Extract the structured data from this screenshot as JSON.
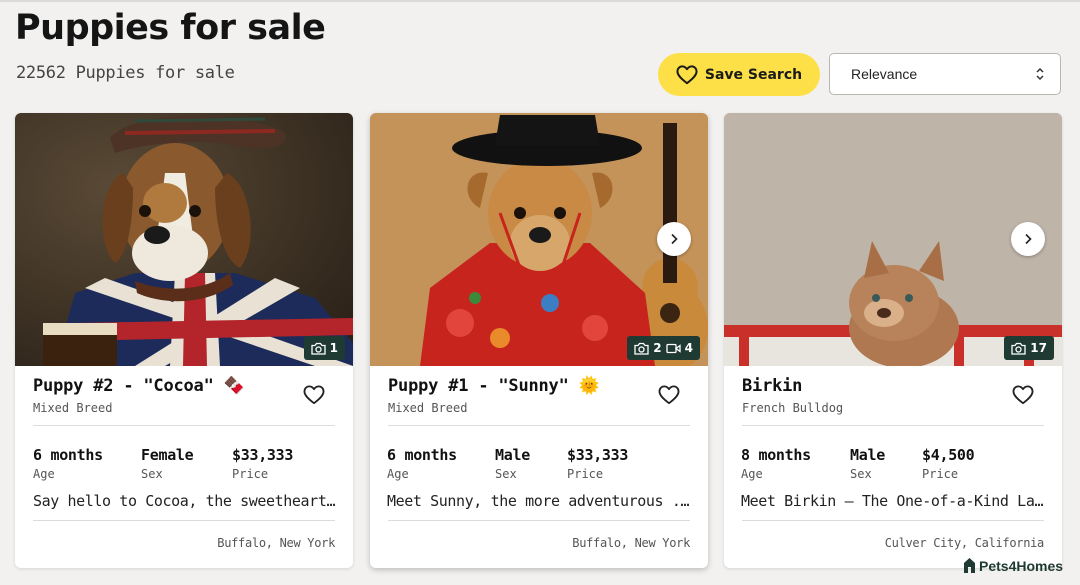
{
  "header": {
    "title": "Puppies for sale",
    "count_text": "22562 Puppies for sale",
    "save_search_label": "Save Search",
    "sort_value": "Relevance"
  },
  "listings": [
    {
      "title": "Puppy #2 - \"Cocoa\" 🍫",
      "breed": "Mixed Breed",
      "photo_count": "1",
      "video_count": "",
      "age": "6 months",
      "age_label": "Age",
      "sex": "Female",
      "sex_label": "Sex",
      "price": "$33,333",
      "price_label": "Price",
      "description": "Say hello to Cocoa, the sweetheart o...",
      "location": "Buffalo, New York"
    },
    {
      "title": "Puppy #1 - \"Sunny\" 🌞",
      "breed": "Mixed Breed",
      "photo_count": "2",
      "video_count": "4",
      "age": "6 months",
      "age_label": "Age",
      "sex": "Male",
      "sex_label": "Sex",
      "price": "$33,333",
      "price_label": "Price",
      "description": "Meet Sunny, the more adventurous ...",
      "location": "Buffalo, New York"
    },
    {
      "title": "Birkin",
      "breed": "French Bulldog",
      "photo_count": "17",
      "video_count": "",
      "age": "8 months",
      "age_label": "Age",
      "sex": "Male",
      "sex_label": "Sex",
      "price": "$4,500",
      "price_label": "Price",
      "description": "Meet Birkin – The One-of-a-Kind La...",
      "location": "Culver City, California"
    }
  ],
  "footer": {
    "brand": "Pets4Homes"
  },
  "colors": {
    "accent_yellow": "#fde047",
    "badge_green": "#1f3a32",
    "background": "#f2f1ef"
  },
  "icons": [
    "heart-icon",
    "camera-icon",
    "video-icon",
    "chevron-right-icon",
    "sort-arrows-icon"
  ]
}
